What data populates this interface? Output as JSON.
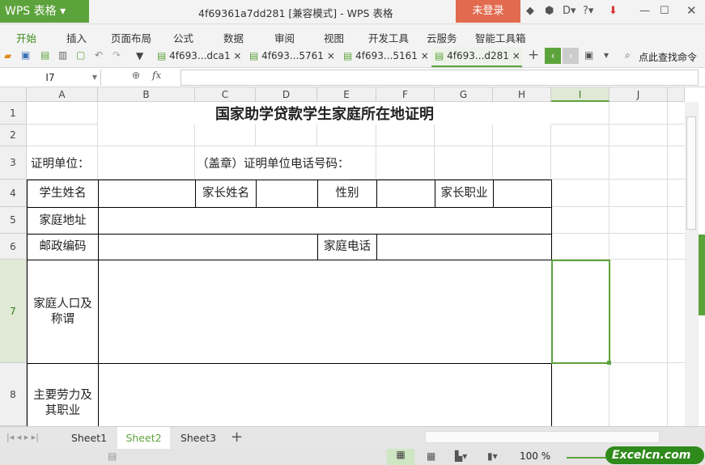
{
  "app": {
    "menu_button": "WPS 表格",
    "title": "4f69361a7dd281 [兼容模式] - WPS 表格",
    "login": "未登录"
  },
  "menus": [
    "开始",
    "插入",
    "页面布局",
    "公式",
    "数据",
    "审阅",
    "视图",
    "开发工具",
    "云服务",
    "智能工具箱"
  ],
  "doc_tabs": [
    "4f693...dca1",
    "4f693...5761",
    "4f693...5161",
    "4f693...d281"
  ],
  "search_cmd": "点此查找命令",
  "formula": {
    "name_box": "I7",
    "fx": "fx",
    "value": ""
  },
  "columns": [
    "A",
    "B",
    "C",
    "D",
    "E",
    "F",
    "G",
    "H",
    "I",
    "J"
  ],
  "rows": [
    "1",
    "2",
    "3",
    "4",
    "5",
    "6",
    "7",
    "8"
  ],
  "sheet": {
    "title": "国家助学贷款学生家庭所在地证明",
    "cert_unit": "证明单位：",
    "stamp_phone": "（盖章）证明单位电话号码：",
    "student_name": "学生姓名",
    "parent_name": "家长姓名",
    "gender": "性别",
    "parent_job": "家长职业",
    "home_addr": "家庭地址",
    "postcode": "邮政编码",
    "home_phone": "家庭电话",
    "family": "家庭人口及称谓",
    "labor": "主要劳力及其职业"
  },
  "sheet_tabs": [
    "Sheet1",
    "Sheet2",
    "Sheet3"
  ],
  "active_sheet": "Sheet2",
  "status": {
    "zoom": "100 %",
    "watermark": "Excelcn.com"
  },
  "colors": {
    "accent": "#5da33c",
    "login": "#e26a4e"
  }
}
